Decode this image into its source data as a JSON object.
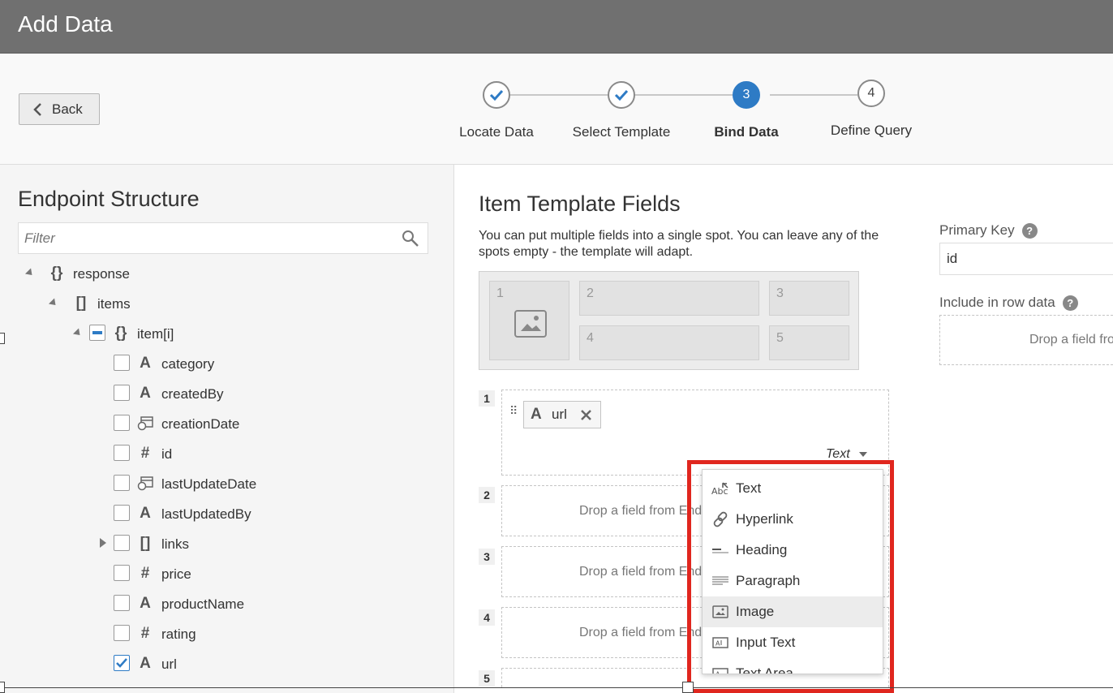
{
  "dialog": {
    "title": "Add Data"
  },
  "wizard": {
    "back_label": "Back",
    "steps": [
      {
        "label": "Locate Data",
        "state": "done"
      },
      {
        "label": "Select Template",
        "state": "done"
      },
      {
        "label": "Bind Data",
        "state": "active",
        "number": "3"
      },
      {
        "label": "Define Query",
        "state": "todo",
        "number": "4"
      }
    ]
  },
  "endpoint": {
    "title": "Endpoint Structure",
    "filter_placeholder": "Filter",
    "nodes": [
      {
        "label": "response",
        "type": "{}"
      },
      {
        "label": "items",
        "type": "[]"
      },
      {
        "label": "item[i]",
        "type": "{}"
      },
      {
        "label": "category",
        "type": "A",
        "checked": false
      },
      {
        "label": "createdBy",
        "type": "A",
        "checked": false
      },
      {
        "label": "creationDate",
        "type": "date",
        "checked": false
      },
      {
        "label": "id",
        "type": "#",
        "checked": false
      },
      {
        "label": "lastUpdateDate",
        "type": "date",
        "checked": false
      },
      {
        "label": "lastUpdatedBy",
        "type": "A",
        "checked": false
      },
      {
        "label": "links",
        "type": "[]",
        "checked": false
      },
      {
        "label": "price",
        "type": "#",
        "checked": false
      },
      {
        "label": "productName",
        "type": "A",
        "checked": false
      },
      {
        "label": "rating",
        "type": "#",
        "checked": false
      },
      {
        "label": "url",
        "type": "A",
        "checked": true
      }
    ]
  },
  "template": {
    "title": "Item Template Fields",
    "description": "You can put multiple fields into a single spot. You can leave any of the spots empty - the template will adapt.",
    "slots": [
      "1",
      "2",
      "3",
      "4",
      "5"
    ],
    "spots": [
      {
        "number": "1",
        "chip": "url",
        "chip_type": "A",
        "display": "Text"
      },
      {
        "number": "2",
        "placeholder": "Drop a field from Endpoint Structure"
      },
      {
        "number": "3",
        "placeholder": "Drop a field from Endpoint Structure"
      },
      {
        "number": "4",
        "placeholder": "Drop a field from Endpoint Structure"
      },
      {
        "number": "5",
        "placeholder": ""
      }
    ]
  },
  "right": {
    "primary_key_label": "Primary Key",
    "primary_key_value": "id",
    "include_label": "Include in row data",
    "include_placeholder": "Drop a field from Endpoint Structure",
    "help": "?"
  },
  "menu": {
    "items": [
      {
        "label": "Text",
        "icon": "text-abc-icon"
      },
      {
        "label": "Hyperlink",
        "icon": "link-icon"
      },
      {
        "label": "Heading",
        "icon": "heading-icon"
      },
      {
        "label": "Paragraph",
        "icon": "paragraph-icon"
      },
      {
        "label": "Image",
        "icon": "image-icon",
        "highlighted": true
      },
      {
        "label": "Input Text",
        "icon": "input-text-icon"
      },
      {
        "label": "Text Area",
        "icon": "text-area-icon"
      }
    ]
  },
  "colors": {
    "accent": "#2e7bc5",
    "highlight": "#e0261e",
    "titlebar": "#707070"
  }
}
